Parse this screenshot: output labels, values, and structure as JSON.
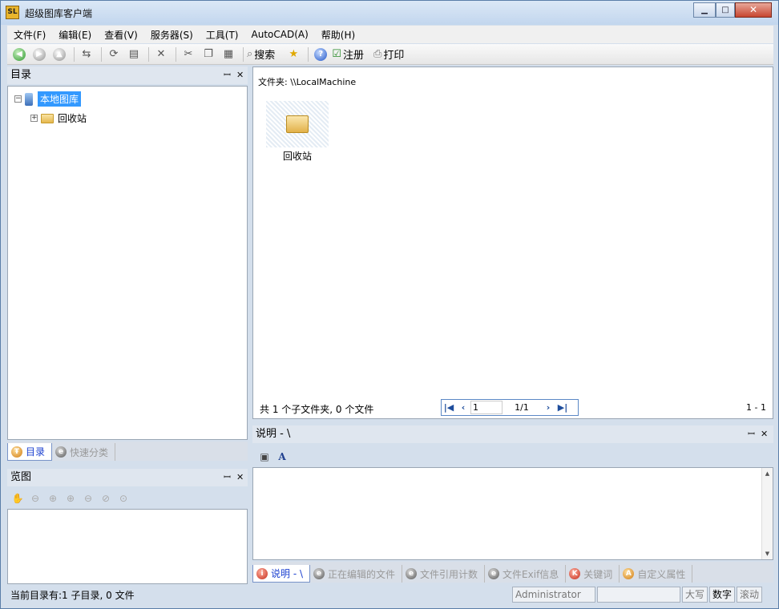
{
  "window": {
    "title": "超级图库客户端",
    "icon_text": "SL",
    "minimize": "▁",
    "maximize": "□",
    "close": "✕"
  },
  "menu": [
    {
      "label": "文件(F)"
    },
    {
      "label": "编辑(E)"
    },
    {
      "label": "查看(V)"
    },
    {
      "label": "服务器(S)"
    },
    {
      "label": "工具(T)"
    },
    {
      "label": "AutoCAD(A)"
    },
    {
      "label": "帮助(H)"
    }
  ],
  "toolbar": {
    "search": "搜索",
    "register": "注册",
    "print": "打印"
  },
  "catalog_panel": {
    "title": "目录",
    "pin": "ꟷ",
    "close": "✕",
    "root": "本地图库",
    "child": "回收站",
    "tabs": [
      "目录",
      "快速分类"
    ]
  },
  "view_panel": {
    "title": "览图",
    "pin": "ꟷ",
    "close": "✕"
  },
  "main": {
    "path": "文件夹: \\\\LocalMachine",
    "folder_label": "回收站",
    "summary": "共 1 个子文件夹, 0 个文件",
    "pager": {
      "page": "1",
      "total": "1/1",
      "range": "1 - 1"
    }
  },
  "desc_panel": {
    "title": "说明 - \\",
    "pin": "ꟷ",
    "close": "✕",
    "tabs": [
      "说明 - \\",
      "正在编辑的文件",
      "文件引用计数",
      "文件Exif信息",
      "关键词",
      "自定义属性"
    ]
  },
  "status": {
    "text": "当前目录有:1 子目录, 0 文件",
    "user": "Administrator",
    "blank": "",
    "caps": "大写",
    "num": "数字",
    "scroll": "滚动"
  }
}
